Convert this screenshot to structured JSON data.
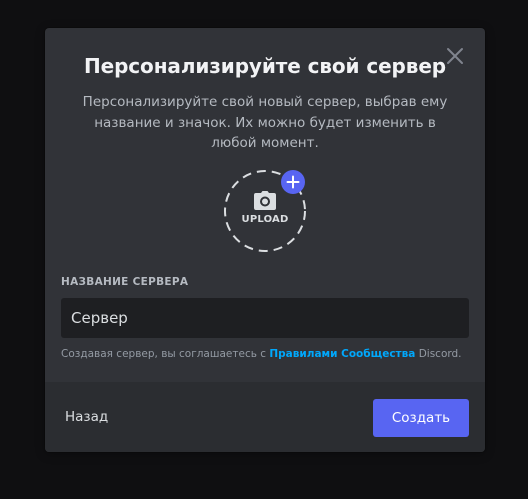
{
  "modal": {
    "title": "Персонализируйте свой сервер",
    "subtitle": "Персонализируйте свой новый сервер, выбрав ему название и значок. Их можно будет изменить в любой момент."
  },
  "upload": {
    "label": "UPLOAD",
    "camera_icon": "camera-icon",
    "plus_icon": "plus-icon"
  },
  "form": {
    "server_name_label": "НАЗВАНИЕ СЕРВЕРА",
    "server_name_value": "Сервер"
  },
  "terms": {
    "prefix": "Создавая сервер, вы соглашаетесь с ",
    "link": "Правилами Сообщества",
    "suffix": " Discord."
  },
  "footer": {
    "back_label": "Назад",
    "create_label": "Создать"
  },
  "colors": {
    "accent": "#5865f2",
    "link": "#00a8fc",
    "modal_bg": "#313338",
    "footer_bg": "#2b2d31",
    "input_bg": "#1e1f22"
  }
}
